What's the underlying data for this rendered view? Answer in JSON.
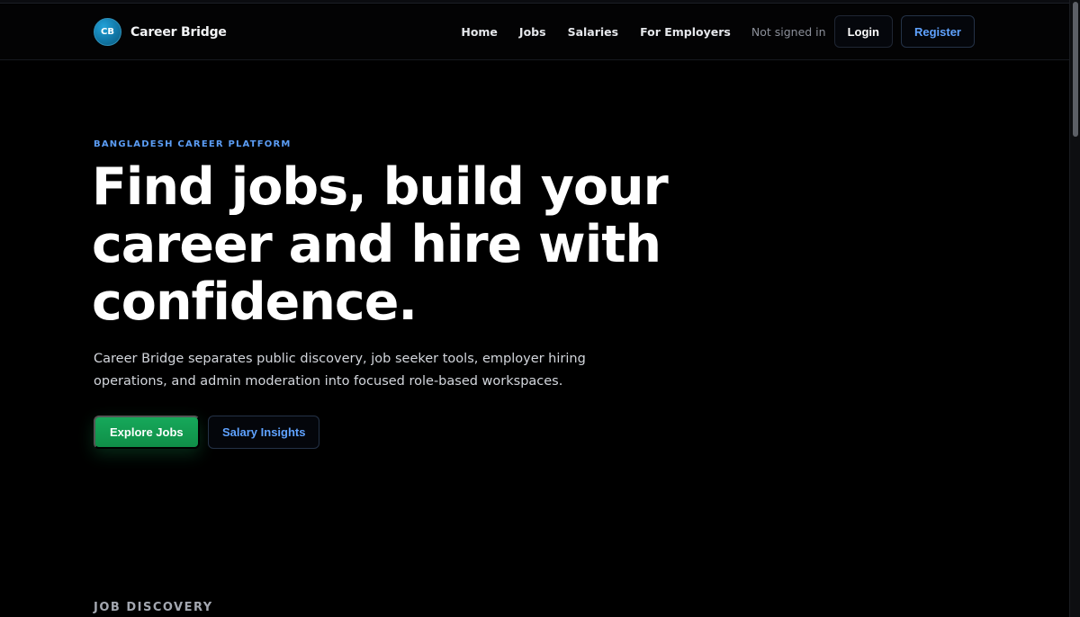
{
  "brand": {
    "logo_initials": "CB",
    "name": "Career Bridge"
  },
  "nav": {
    "links": [
      "Home",
      "Jobs",
      "Salaries",
      "For Employers"
    ],
    "status": "Not signed in",
    "login_label": "Login",
    "register_label": "Register"
  },
  "hero": {
    "eyebrow": "BANGLADESH CAREER PLATFORM",
    "title": "Find jobs, build your career and hire with confidence.",
    "subtitle": "Career Bridge separates public discovery, job seeker tools, employer hiring operations, and admin moderation into focused role-based workspaces.",
    "primary_cta": "Explore Jobs",
    "secondary_cta": "Salary Insights"
  },
  "section": {
    "label": "JOB DISCOVERY"
  },
  "colors": {
    "accent_blue": "#5fa2ff",
    "accent_green": "#16a85a",
    "background": "#000000"
  }
}
